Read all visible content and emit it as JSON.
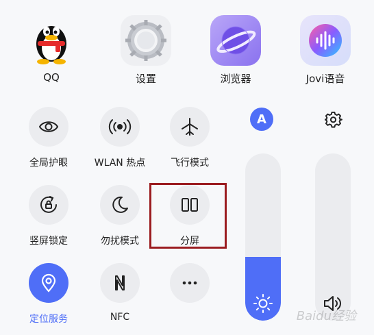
{
  "apps": [
    {
      "label": "QQ",
      "icon": "qq-penguin-icon"
    },
    {
      "label": "设置",
      "icon": "settings-gear-icon"
    },
    {
      "label": "浏览器",
      "icon": "browser-planet-icon"
    },
    {
      "label": "Jovi语音",
      "icon": "jovi-voice-icon"
    }
  ],
  "tiles": [
    {
      "label": "全局护眼",
      "icon": "eye-icon",
      "active": false
    },
    {
      "label": "WLAN 热点",
      "icon": "hotspot-icon",
      "active": false
    },
    {
      "label": "飞行模式",
      "icon": "airplane-icon",
      "active": false
    },
    {
      "label": "竖屏锁定",
      "icon": "rotation-lock-icon",
      "active": false
    },
    {
      "label": "勿扰模式",
      "icon": "moon-icon",
      "active": false
    },
    {
      "label": "分屏",
      "icon": "split-screen-icon",
      "active": false
    },
    {
      "label": "定位服务",
      "icon": "location-icon",
      "active": true
    },
    {
      "label": "NFC",
      "icon": "nfc-icon",
      "active": false
    },
    {
      "label": "",
      "icon": "more-icon",
      "active": false
    }
  ],
  "brightness": {
    "auto_label": "A",
    "level": 0.38
  },
  "volume": {
    "level": 0
  },
  "watermark": "Baidu经验",
  "colors": {
    "accent": "#4f6ef7",
    "highlight": "#9b1c20",
    "tile_bg": "#ebecef"
  }
}
